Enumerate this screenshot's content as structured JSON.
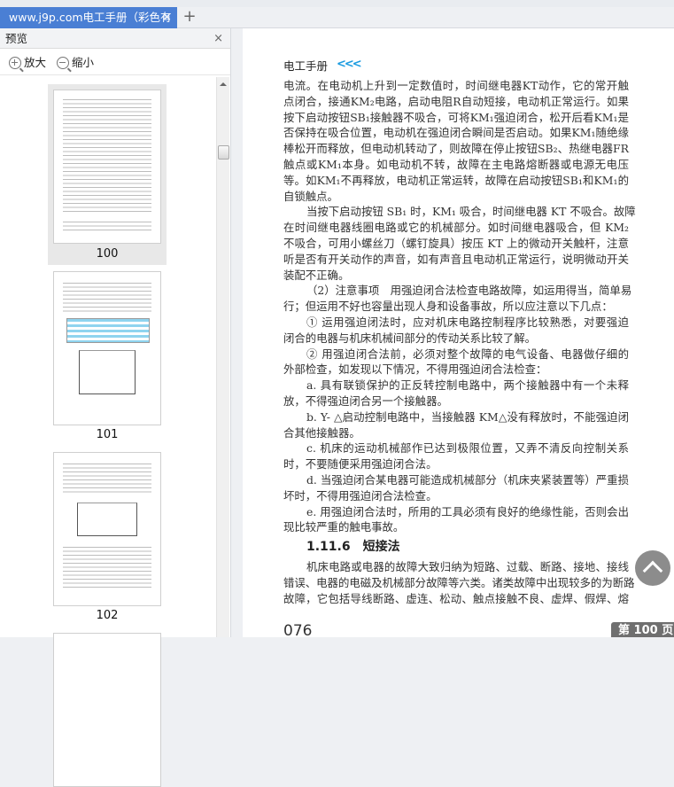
{
  "tab": {
    "title": "www.j9p.com电工手册（彩色有",
    "close": "×",
    "new_tab": "+"
  },
  "preview": {
    "title": "预览",
    "close": "×",
    "zoom_in": "放大",
    "zoom_out": "缩小",
    "pages": [
      {
        "label": "100"
      },
      {
        "label": "101"
      },
      {
        "label": "102"
      }
    ]
  },
  "document": {
    "running_header": "电工手册",
    "header_arrows": "<<<",
    "para1": [
      "电流。在电动机上升到一定数值时，时间继电器KT动作，它的常开触",
      "点闭合，接通KM₂电路，启动电阻R自动短接，电动机正常运行。如果",
      "按下启动按钮SB₁接触器不吸合，可将KM₁强迫闭合，松开后看KM₁是",
      "否保持在吸合位置，电动机在强迫闭合瞬间是否启动。如果KM₁随绝缘",
      "棒松开而释放，但电动机转动了，则故障在停止按钮SB₂、热继电器FR",
      "触点或KM₁本身。如电动机不转，故障在主电路熔断器或电源无电压",
      "等。如KM₁不再释放，电动机正常运转，故障在启动按钮SB₁和KM₁的",
      "自锁触点。"
    ],
    "para2": [
      "当按下启动按钮 SB₁ 时，KM₁ 吸合，时间继电器 KT 不吸合。故障",
      "在时间继电器线圈电路或它的机械部分。如时间继电器吸合，但 KM₂",
      "不吸合，可用小螺丝刀（螺钉旋具）按压 KT 上的微动开关触杆，注意",
      "听是否有开关动作的声音，如有声音且电动机正常运行，说明微动开关",
      "装配不正确。"
    ],
    "para3": [
      "（2）注意事项　用强迫闭合法检查电路故障，如运用得当，简单易",
      "行；但运用不好也容量出现人身和设备事故，所以应注意以下几点："
    ],
    "para4": [
      "① 运用强迫闭法时，应对机床电路控制程序比较熟悉，对要强迫",
      "闭合的电器与机床机械间部分的传动关系比较了解。"
    ],
    "para5": [
      "② 用强迫闭合法前，必须对整个故障的电气设备、电器做仔细的",
      "外部检查，如发现以下情况，不得用强迫闭合法检查："
    ],
    "item_a": [
      "a. 具有联锁保护的正反转控制电路中，两个接触器中有一个未释",
      "放，不得强迫闭合另一个接触器。"
    ],
    "item_b": [
      "b. Y- △启动控制电路中，当接触器 KM△没有释放时，不能强迫闭",
      "合其他接触器。"
    ],
    "item_c": [
      "c. 机床的运动机械部作已达到极限位置，又弄不清反向控制关系",
      "时，不要随便采用强迫闭合法。"
    ],
    "item_d": [
      "d. 当强迫闭合某电器可能造成机械部分（机床夹紧装置等）严重损",
      "坏时，不得用强迫闭合法检查。"
    ],
    "item_e": [
      "e. 用强迫闭合法时，所用的工具必须有良好的绝缘性能，否则会出",
      "现比较严重的触电事故。"
    ],
    "section": "1.11.6　短接法",
    "para6": [
      "机床电路或电器的故障大致归纳为短路、过载、断路、接地、接线",
      "错误、电器的电磁及机械部分故障等六类。诸类故障中出现较多的为断路",
      "故障，它包括导线断路、虚连、松动、触点接触不良、虚焊、假焊、熔"
    ],
    "page_number": "076"
  },
  "page_indicator": "第 100 页",
  "colors": {
    "tab": "#4a7fd4",
    "accent": "#1a9be0"
  }
}
